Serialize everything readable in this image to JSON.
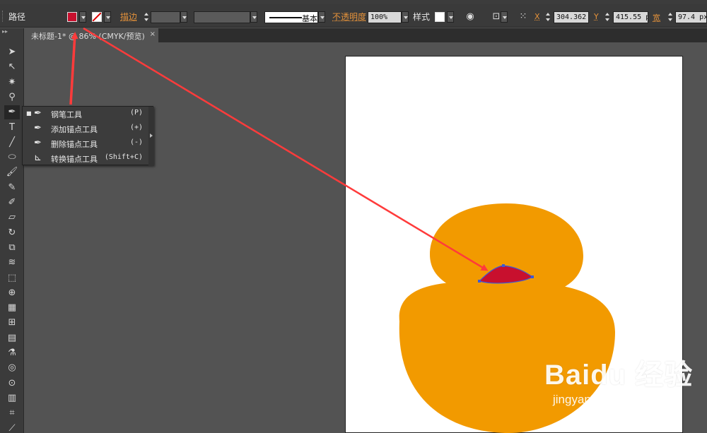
{
  "control_bar": {
    "selection_type": "路径",
    "fill_color": "#c8102e",
    "stroke_label": "描边",
    "stroke_style_label": "基本",
    "opacity_label": "不透明度",
    "opacity_value": "100%",
    "style_label": "样式",
    "x_label": "X",
    "x_value": "304.362",
    "y_label": "Y",
    "y_value": "415.55 px",
    "w_label": "宽",
    "w_value": "97.4 px"
  },
  "document_tab": {
    "title": "未标题-1* @ 86% (CMYK/预览)",
    "close_glyph": "×"
  },
  "toolbar": {
    "tools": [
      {
        "name": "selection-tool",
        "glyph": "➤"
      },
      {
        "name": "direct-selection-tool",
        "glyph": "↖"
      },
      {
        "name": "magic-wand-tool",
        "glyph": "✷"
      },
      {
        "name": "lasso-tool",
        "glyph": "⚲"
      },
      {
        "name": "pen-tool",
        "glyph": "✒"
      },
      {
        "name": "type-tool",
        "glyph": "T"
      },
      {
        "name": "line-segment-tool",
        "glyph": "╱"
      },
      {
        "name": "ellipse-tool",
        "glyph": "⬭"
      },
      {
        "name": "paintbrush-tool",
        "glyph": "🖌"
      },
      {
        "name": "pencil-tool",
        "glyph": "✎"
      },
      {
        "name": "blob-brush-tool",
        "glyph": "✐"
      },
      {
        "name": "eraser-tool",
        "glyph": "▱"
      },
      {
        "name": "rotate-tool",
        "glyph": "↻"
      },
      {
        "name": "scale-tool",
        "glyph": "⧉"
      },
      {
        "name": "warp-tool",
        "glyph": "≋"
      },
      {
        "name": "free-transform-tool",
        "glyph": "⬚"
      },
      {
        "name": "shape-builder-tool",
        "glyph": "⊕"
      },
      {
        "name": "perspective-grid-tool",
        "glyph": "▦"
      },
      {
        "name": "mesh-tool",
        "glyph": "⊞"
      },
      {
        "name": "gradient-tool",
        "glyph": "▤"
      },
      {
        "name": "eyedropper-tool",
        "glyph": "⚗"
      },
      {
        "name": "blend-tool",
        "glyph": "◎"
      },
      {
        "name": "symbol-sprayer-tool",
        "glyph": "⊙"
      },
      {
        "name": "column-graph-tool",
        "glyph": "▥"
      },
      {
        "name": "artboard-tool",
        "glyph": "⌗"
      },
      {
        "name": "slice-tool",
        "glyph": "⟋"
      }
    ]
  },
  "flyout_menu": {
    "items": [
      {
        "label": "钢笔工具",
        "shortcut": "(P)",
        "icon": "pen-icon",
        "glyph": "✒",
        "selected": true
      },
      {
        "label": "添加锚点工具",
        "shortcut": "(+)",
        "icon": "add-anchor-icon",
        "glyph": "✒",
        "selected": false
      },
      {
        "label": "删除锚点工具",
        "shortcut": "(-)",
        "icon": "delete-anchor-icon",
        "glyph": "✒",
        "selected": false
      },
      {
        "label": "转换锚点工具",
        "shortcut": "(Shift+C)",
        "icon": "convert-anchor-icon",
        "glyph": "⊾",
        "selected": false
      }
    ],
    "bullet": "■"
  },
  "artwork": {
    "body_color": "#f29a00",
    "beak_color": "#c8102e",
    "path_outline_color": "#3a5bd9"
  },
  "annotations": {
    "arrow_color": "#ff3b3b"
  },
  "watermark": {
    "brand": "Baidu 经验",
    "url": "jingyan.baidu.com"
  }
}
